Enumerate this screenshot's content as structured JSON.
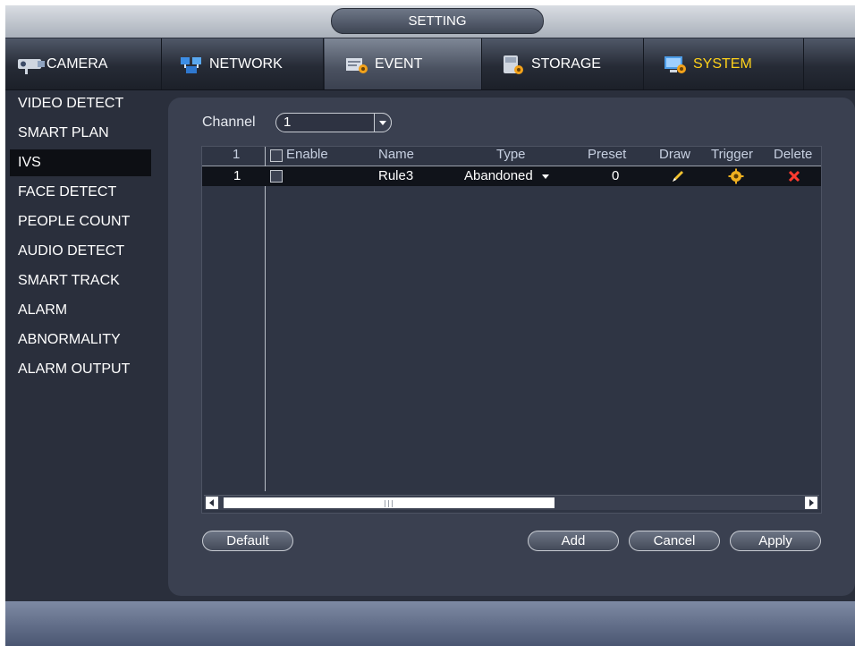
{
  "window": {
    "title": "SETTING"
  },
  "tabs": [
    {
      "label": "CAMERA",
      "icon": "camera-icon"
    },
    {
      "label": "NETWORK",
      "icon": "network-icon"
    },
    {
      "label": "EVENT",
      "icon": "event-icon"
    },
    {
      "label": "STORAGE",
      "icon": "storage-icon"
    },
    {
      "label": "SYSTEM",
      "icon": "system-icon"
    }
  ],
  "sidebar": {
    "items": [
      {
        "label": "VIDEO DETECT"
      },
      {
        "label": "SMART PLAN"
      },
      {
        "label": "IVS"
      },
      {
        "label": "FACE DETECT"
      },
      {
        "label": "PEOPLE COUNT"
      },
      {
        "label": "AUDIO DETECT"
      },
      {
        "label": "SMART TRACK"
      },
      {
        "label": "ALARM"
      },
      {
        "label": "ABNORMALITY"
      },
      {
        "label": "ALARM OUTPUT"
      }
    ],
    "selected": "IVS"
  },
  "channel": {
    "label": "Channel",
    "value": "1"
  },
  "table": {
    "headers": {
      "index": "1",
      "enable": "Enable",
      "name": "Name",
      "type": "Type",
      "preset": "Preset",
      "draw": "Draw",
      "trigger": "Trigger",
      "delete": "Delete"
    },
    "rows": [
      {
        "index": "1",
        "enable": false,
        "name": "Rule3",
        "type": "Abandoned",
        "preset": "0"
      }
    ]
  },
  "buttons": {
    "default": "Default",
    "add": "Add",
    "cancel": "Cancel",
    "apply": "Apply"
  },
  "colors": {
    "accent_system": "#ffd21a",
    "delete_red": "#ff3b2f",
    "trigger_gold": "#f0b020"
  }
}
